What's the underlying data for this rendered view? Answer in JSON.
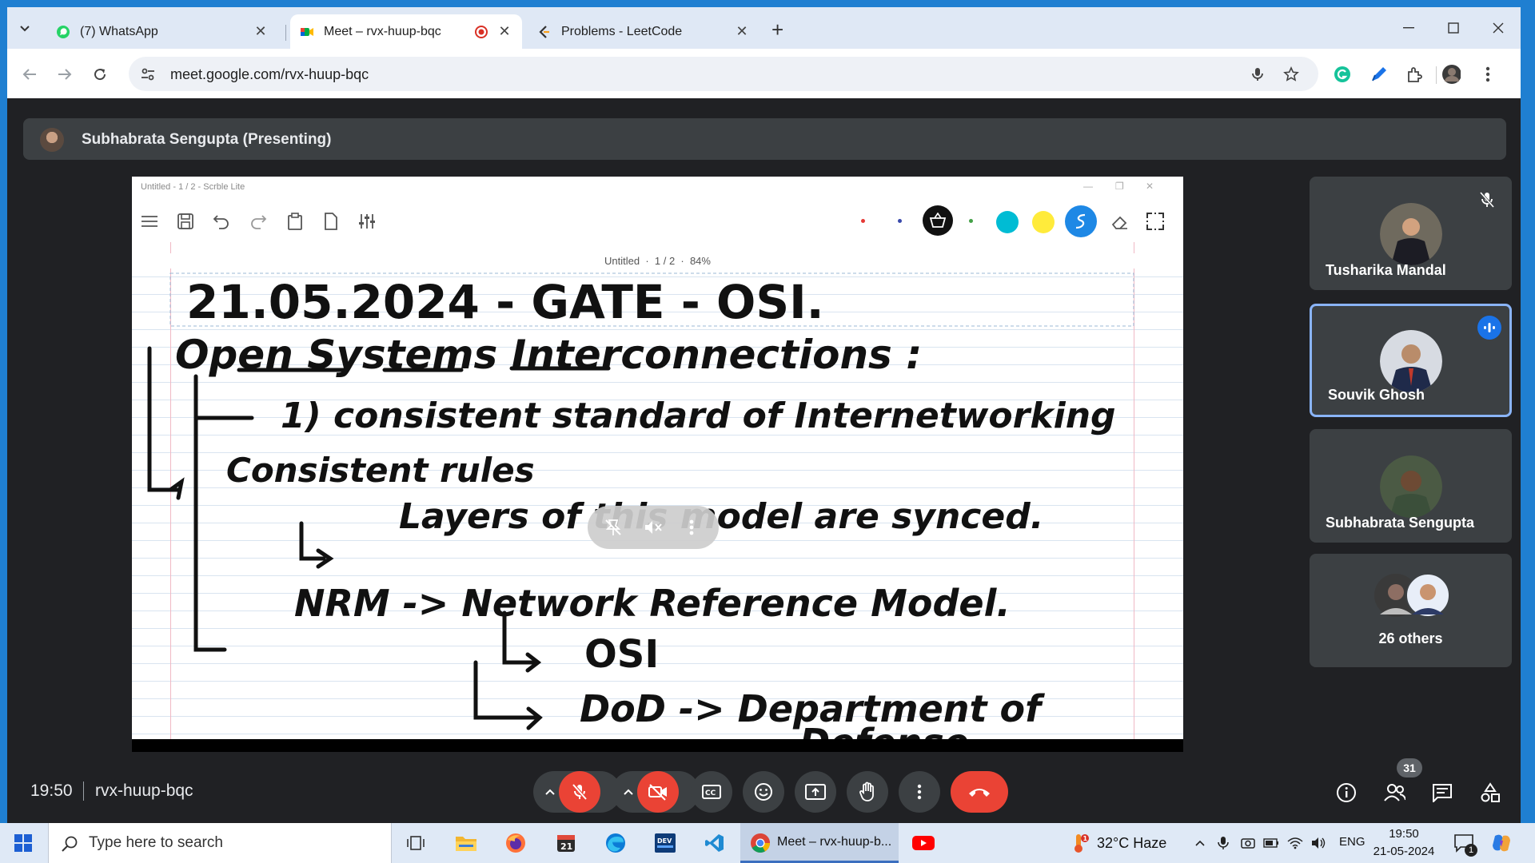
{
  "browser": {
    "tabs": [
      {
        "title": "(7) WhatsApp",
        "favicon": "whatsapp-icon",
        "active": false
      },
      {
        "title": "Meet – rvx-huup-bqc",
        "favicon": "google-meet-icon",
        "active": true,
        "recording": true
      },
      {
        "title": "Problems - LeetCode",
        "favicon": "leetcode-icon",
        "active": false
      }
    ],
    "url": "meet.google.com/rvx-huup-bqc"
  },
  "meet": {
    "presenter_label": "Subhabrata Sengupta (Presenting)",
    "shared_app": {
      "window_title": "Untitled - 1 / 2 - Scrble Lite",
      "doc_name": "Untitled",
      "page": "1 / 2",
      "zoom": "84%",
      "pen_colors": [
        "#e53935",
        "#3949ab",
        "#43a047",
        "#00bcd4",
        "#ffeb3b",
        "#1e88e5"
      ],
      "handwritten_notes": [
        "21.05.2024 - GATE - OSI.",
        "Open Systems Interconnections :",
        "1) consistent standard of Internetworking",
        "Consistent rules",
        "Layers of this model are synced.",
        "NRM -> Network Reference Model.",
        "OSI",
        "DoD -> Department of",
        "Defense"
      ]
    },
    "participants": [
      {
        "name": "Tusharika Mandal",
        "muted": true,
        "speaking": false
      },
      {
        "name": "Souvik Ghosh",
        "muted": false,
        "speaking": true
      },
      {
        "name": "Subhabrata Sengupta",
        "muted": false,
        "speaking": false
      }
    ],
    "others_label": "26 others",
    "time": "19:50",
    "meeting_code": "rvx-huup-bqc",
    "people_count": "31"
  },
  "taskbar": {
    "search_placeholder": "Type here to search",
    "active_app_label": "Meet – rvx-huup-b...",
    "calendar_day": "21",
    "weather_badge": "1",
    "weather": "32°C  Haze",
    "language": "ENG",
    "time": "19:50",
    "date": "21-05-2024",
    "notification_count": "1"
  }
}
